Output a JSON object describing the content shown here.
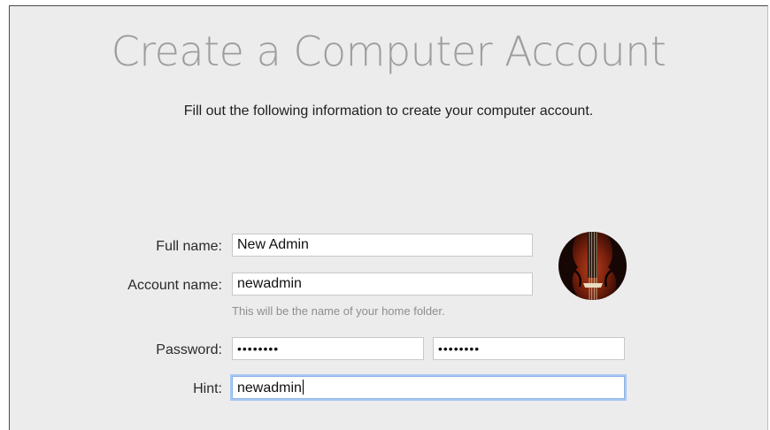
{
  "page": {
    "title": "Create a Computer Account",
    "subtitle": "Fill out the following information to create your computer account."
  },
  "form": {
    "full_name": {
      "label": "Full name:",
      "value": "New Admin"
    },
    "account_name": {
      "label": "Account name:",
      "value": "newadmin",
      "help": "This will be the name of your home folder."
    },
    "password": {
      "label": "Password:",
      "value": "••••••••",
      "verify_value": "••••••••"
    },
    "hint": {
      "label": "Hint:",
      "value": "newadmin"
    }
  },
  "avatar": {
    "icon": "violin-icon"
  },
  "colors": {
    "window_background": "#ececec",
    "title": "#9d9d9d",
    "focus_ring": "#a9c8f2"
  }
}
